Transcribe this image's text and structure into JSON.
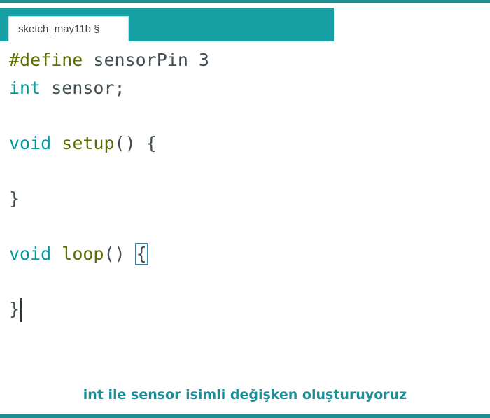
{
  "tab": {
    "label": "sketch_may11b §"
  },
  "code": {
    "l1_pre": "#define",
    "l1_rest": " sensorPin 3",
    "l2_type": "int",
    "l2_rest": " sensor;",
    "l4_type": "void",
    "l4_fn": "setup",
    "l4_rest": "() {",
    "l6_brace": "}",
    "l8_type": "void",
    "l8_fn": "loop",
    "l8_rest": "() ",
    "l8_brace": "{",
    "l10_brace": "}"
  },
  "caption": "int ile sensor isimli değişken oluşturuyoruz",
  "colors": {
    "accent": "#17a1a5",
    "keyword_type": "#00979c",
    "keyword_function": "#5e6d03",
    "caption": "#1b8f98"
  }
}
